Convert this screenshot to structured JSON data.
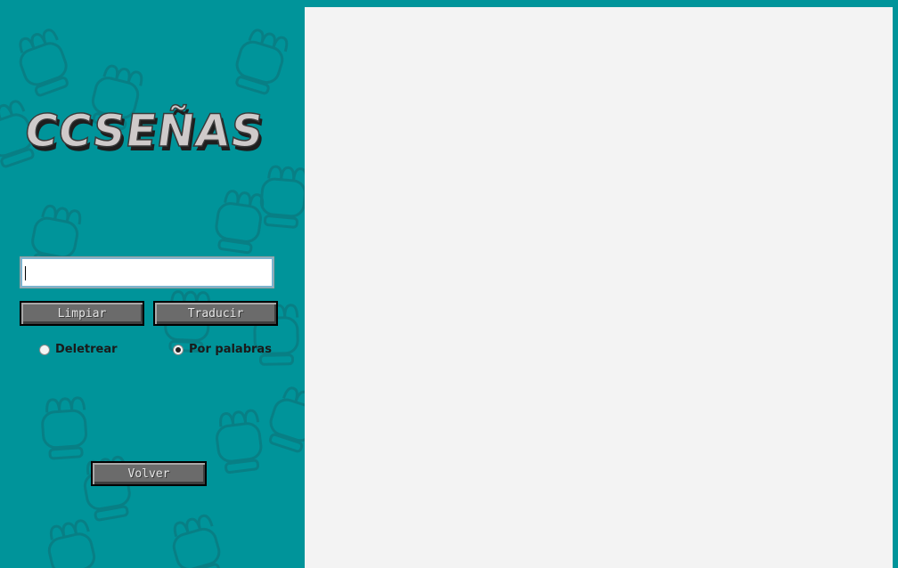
{
  "app": {
    "logo_text": "CCSEÑAS"
  },
  "controls": {
    "text_input_value": "",
    "clear_label": "Limpiar",
    "translate_label": "Traducir",
    "back_label": "Volver"
  },
  "mode": {
    "options": [
      {
        "label": "Deletrear",
        "selected": false
      },
      {
        "label": "Por palabras",
        "selected": true
      }
    ]
  },
  "colors": {
    "background": "#00949a",
    "content_panel": "#f3f3f3",
    "button_face": "#6b6b6b"
  },
  "icons": {
    "background_pattern": "hand-sign-icon"
  }
}
